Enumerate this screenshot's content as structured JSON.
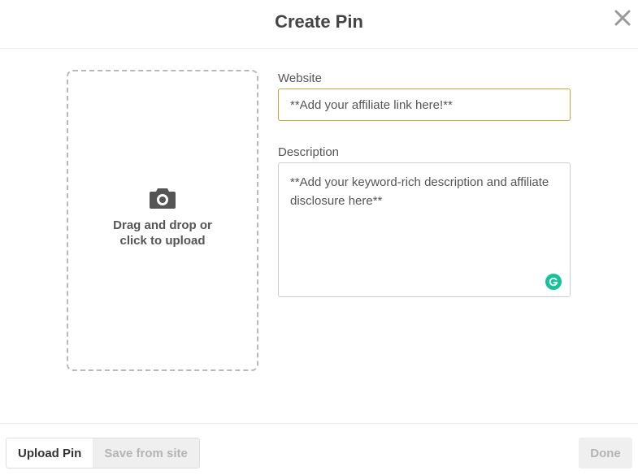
{
  "header": {
    "title": "Create Pin",
    "close_icon": "close-icon"
  },
  "upload": {
    "icon": "camera-icon",
    "text": "Drag and drop or click to upload"
  },
  "form": {
    "website_label": "Website",
    "website_placeholder": "**Add your affiliate link here!**",
    "website_value": "",
    "description_label": "Description",
    "description_placeholder": "**Add your keyword-rich description and affiliate disclosure here**",
    "description_value": "",
    "grammarly_icon": "grammarly-icon"
  },
  "footer": {
    "tabs": [
      {
        "label": "Upload Pin",
        "active": true
      },
      {
        "label": "Save from site",
        "active": false
      }
    ],
    "done_label": "Done"
  },
  "colors": {
    "accent_border": "#c9a23e",
    "grammarly": "#15c39a",
    "disabled_bg": "#efefef",
    "disabled_text": "#b4b4b4"
  }
}
